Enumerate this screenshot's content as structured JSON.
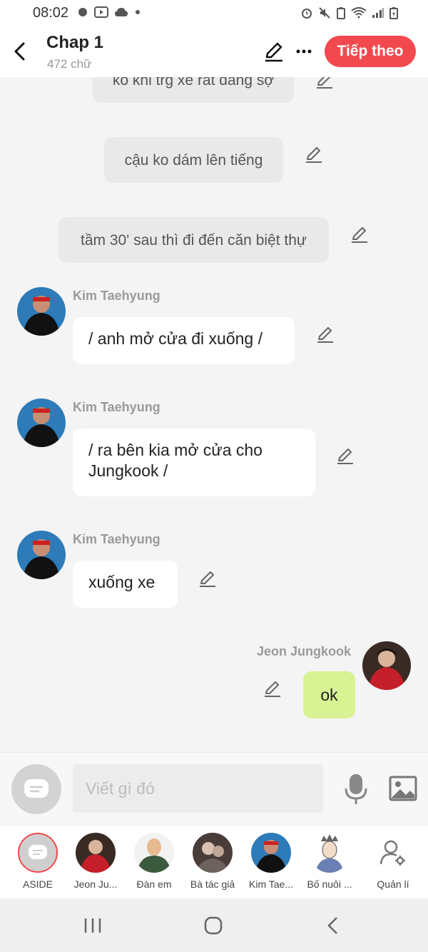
{
  "status_bar": {
    "time": "08:02"
  },
  "header": {
    "title": "Chap 1",
    "word_count": "472 chữ",
    "next_label": "Tiếp theo"
  },
  "messages": {
    "narration": [
      "ko khi trg xe rất đáng sợ",
      "cậu ko dám lên tiếng",
      "tầm 30' sau thì đi đến căn biệt thự"
    ],
    "dialogue": [
      {
        "speaker": "Kim Taehyung",
        "text": "/ anh mở cửa đi xuống /"
      },
      {
        "speaker": "Kim Taehyung",
        "text": "/ ra bên kia mở cửa cho Jungkook /"
      },
      {
        "speaker": "Kim Taehyung",
        "text": "xuống xe"
      },
      {
        "speaker": "Jeon Jungkook",
        "text": "ok"
      }
    ]
  },
  "composer": {
    "placeholder": "Viết gì đó"
  },
  "characters": [
    {
      "label": "ASIDE"
    },
    {
      "label": "Jeon Ju..."
    },
    {
      "label": "Đàn em"
    },
    {
      "label": "Bà tác giả"
    },
    {
      "label": "Kim Tae..."
    },
    {
      "label": "Bố nuôi ..."
    },
    {
      "label": "Quản lí"
    }
  ],
  "colors": {
    "accent": "#f2494e",
    "own_bubble": "#d8f393",
    "narration_bubble": "#e9e9e9"
  },
  "icons": [
    "back-icon",
    "pencil-icon",
    "more-icon",
    "mic-icon",
    "image-icon",
    "settings-user-icon",
    "recent-apps-icon",
    "home-icon",
    "nav-back-icon"
  ]
}
